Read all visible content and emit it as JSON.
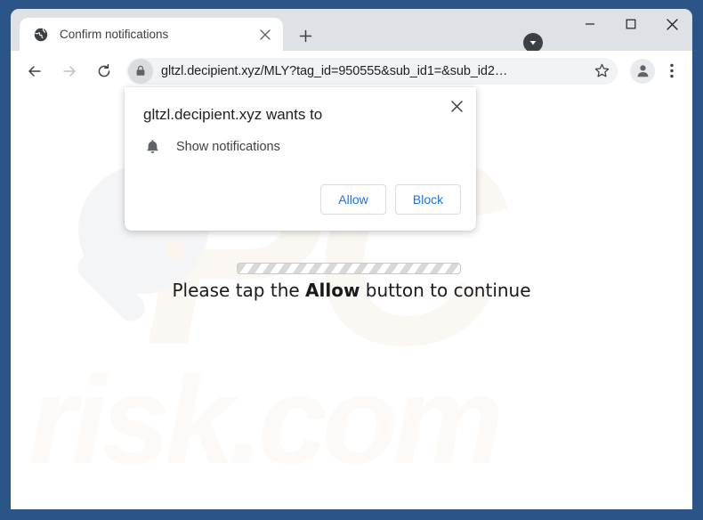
{
  "browser": {
    "tab": {
      "favicon": "globe-icon",
      "title": "Confirm notifications",
      "close_label": "×"
    },
    "new_tab_label": "+",
    "window_controls": {
      "badge_icon": "chevron-down-circle-icon",
      "minimize": "─",
      "maximize": "□",
      "close": "✕"
    },
    "toolbar": {
      "back_icon": "back-arrow-icon",
      "forward_icon": "forward-arrow-icon",
      "reload_icon": "reload-icon",
      "site_info_icon": "lock-icon",
      "url": "gltzl.decipient.xyz/MLY?tag_id=950555&sub_id1=&sub_id2…",
      "bookmark_icon": "star-icon",
      "profile_icon": "profile-avatar-icon",
      "menu_icon": "three-dots-menu-icon"
    },
    "frame_color": "#2b5589",
    "tabstrip_color": "#dee1e6"
  },
  "dialog": {
    "heading": "gltzl.decipient.xyz wants to",
    "close_label": "✕",
    "permission_icon": "bell-icon",
    "permission_label": "Show notifications",
    "allow_label": "Allow",
    "block_label": "Block",
    "button_text_color": "#1a73e8"
  },
  "page": {
    "progress": {
      "name": "striped-progress-bar",
      "style": "indeterminate-striped"
    },
    "message_prefix": "Please tap the ",
    "message_emphasis": "Allow",
    "message_suffix": " button to continue",
    "watermark": {
      "brand_top": "PC",
      "brand_bottom": "risk.com",
      "glass_icon": "magnifying-glass-icon"
    }
  }
}
